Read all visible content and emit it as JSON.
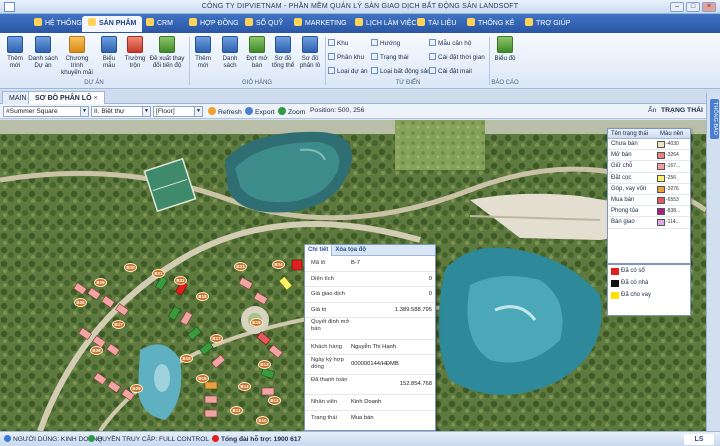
{
  "window": {
    "title": "CÔNG TY DIPVIETNAM - PHẦN MỀM QUẢN LÝ SÀN GIAO DỊCH BẤT ĐỘNG SẢN LANDSOFT"
  },
  "ribbon_tabs": [
    {
      "label": "HỆ THỐNG",
      "active": false
    },
    {
      "label": "SẢN PHẨM",
      "active": true
    },
    {
      "label": "CRM",
      "active": false
    },
    {
      "label": "HỢP ĐỒNG",
      "active": false
    },
    {
      "label": "SỔ QUỸ",
      "active": false
    },
    {
      "label": "MARKETING",
      "active": false
    },
    {
      "label": "LỊCH LÀM VIỆC",
      "active": false
    },
    {
      "label": "TÀI LIỆU",
      "active": false
    },
    {
      "label": "THỐNG KÊ",
      "active": false
    },
    {
      "label": "TRỢ GIÚP",
      "active": false
    }
  ],
  "ribbon": {
    "group_du_an": {
      "label": "DỰ ÁN",
      "buttons": [
        "Thêm mới",
        "Danh sách Dự án",
        "Chương trình khuyến mãi",
        "Biểu mẫu",
        "Trường trộn",
        "Đề xuất thay đổi tiến độ"
      ]
    },
    "group_gio_hang": {
      "label": "GIỎ HÀNG",
      "buttons": [
        "Thêm mới",
        "Danh sách",
        "Đợt mở bán",
        "Sơ đồ tổng thể",
        "Sơ đồ phân lô"
      ]
    },
    "group_tu_dien": {
      "label": "TỪ ĐIỂN",
      "col1": [
        "Khu",
        "Phân khu",
        "Loại dự án"
      ],
      "col2": [
        "Hướng",
        "Trạng thái",
        "Loại bất động sản"
      ],
      "col3": [
        "Mẫu căn hộ",
        "Cài đặt thời gian",
        "Cài đặt mail"
      ]
    },
    "group_bao_cao": {
      "label": "BÁO CÁO",
      "buttons": [
        "Biểu đồ"
      ]
    }
  },
  "doc_tabs": [
    {
      "label": "MAIN",
      "active": false
    },
    {
      "label": "SƠ ĐỒ PHÂN LÔ",
      "active": true
    }
  ],
  "toolbar": {
    "project": "#Summer Square",
    "block": "II. Biệt thự",
    "floor": "[Floor]",
    "refresh": "Refresh",
    "export": "Export",
    "zoom": "Zoom",
    "position": "Position: 500, 256",
    "hide_label": "Ẩn",
    "status_label": "TRẠNG THÁI"
  },
  "side_panel": {
    "label": "THÔNG BÁO"
  },
  "legend": {
    "headers": [
      "Tên trạng thái",
      "Màu nền"
    ],
    "rows": [
      {
        "name": "Chưa bán",
        "color": "#f3e3c3",
        "code": "-4030"
      },
      {
        "name": "Mở bán",
        "color": "#ee7e7e",
        "code": "-3264"
      },
      {
        "name": "Giữ chỗ",
        "color": "#f1a1a1",
        "code": "-167..."
      },
      {
        "name": "Đặt cọc",
        "color": "#fff26a",
        "code": "-256"
      },
      {
        "name": "Góp, vay vốn",
        "color": "#e8a040",
        "code": "-3276"
      },
      {
        "name": "Mua bán",
        "color": "#e05a5a",
        "code": "-6553"
      },
      {
        "name": "Phong tỏa",
        "color": "#a61e84",
        "code": "-838..."
      },
      {
        "name": "Bàn giao",
        "color": "#e0a8e8",
        "code": "-114..."
      }
    ]
  },
  "legend2": [
    {
      "label": "Đã có sổ",
      "color": "#e0201c"
    },
    {
      "label": "Đã có nhà",
      "color": "#111111"
    },
    {
      "label": "Đã cho vay",
      "color": "#ffe000"
    }
  ],
  "detail": {
    "tabs": [
      "Chi tiết",
      "Xóa tọa độ"
    ],
    "rows": [
      {
        "label": "Mã lô",
        "value": "B-7",
        "align": "left"
      },
      {
        "label": "Diện tích",
        "value": "0",
        "align": "right"
      },
      {
        "label": "Giá giao dịch",
        "value": "0",
        "align": "right"
      },
      {
        "label": "Giá trị",
        "value": "1.389.588.795",
        "align": "right"
      },
      {
        "label": "Quyết định mở bán",
        "value": "",
        "align": "left"
      },
      {
        "label": "Khách hàng",
        "value": "Nguyễn Thị Hạnh",
        "align": "left"
      },
      {
        "label": "Ngày ký hợp đồng",
        "value": "000000144/HĐMB",
        "align": "left"
      },
      {
        "label": "Đã thanh toán",
        "value": "152.854.768",
        "align": "right"
      },
      {
        "label": "Nhân viên",
        "value": "Kinh Doanh",
        "align": "left"
      },
      {
        "label": "Trạng thái",
        "value": "Mua bán",
        "align": "left"
      }
    ]
  },
  "lot_labels": [
    "B20",
    "B21",
    "B22",
    "B23",
    "B24",
    "B25",
    "B26",
    "B27",
    "B18",
    "B19",
    "B17",
    "B16",
    "B15",
    "B13",
    "B14",
    "B12",
    "B11",
    "B10",
    "B28",
    "B29"
  ],
  "status": {
    "user": "NGƯỜI DÙNG: KINH DOANH",
    "access": "QUYỀN TRUY CẬP: FULL CONTROL",
    "hotline": "Tổng đài hỗ trợ: 1900 617"
  }
}
